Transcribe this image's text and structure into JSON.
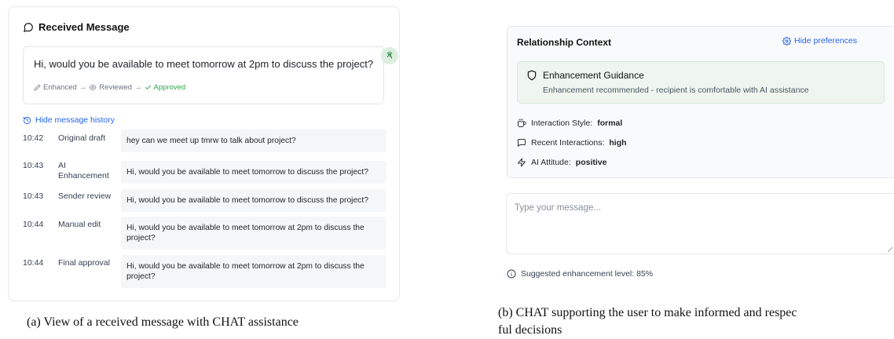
{
  "panel_a": {
    "header": "Received Message",
    "message": "Hi, would you be available to meet tomorrow at 2pm to discuss the project?",
    "pipeline": {
      "enhanced": "Enhanced",
      "reviewed": "Reviewed",
      "approved": "Approved",
      "arrow": "→"
    },
    "history_toggle": "Hide message history",
    "history": [
      {
        "time": "10:42",
        "label": "Original draft",
        "text": "hey can we meet up tmrw to talk about project?"
      },
      {
        "time": "10:43",
        "label": "AI Enhancement",
        "text": "Hi, would you be available to meet tomorrow to discuss the project?"
      },
      {
        "time": "10:43",
        "label": "Sender review",
        "text": "Hi, would you be available to meet tomorrow to discuss the project?"
      },
      {
        "time": "10:44",
        "label": "Manual edit",
        "text": "Hi, would you be available to meet tomorrow at 2pm to discuss the project?"
      },
      {
        "time": "10:44",
        "label": "Final approval",
        "text": "Hi, would you be available to meet tomorrow at 2pm to discuss the project?"
      }
    ],
    "caption": "(a) View of a received message with CHAT assistance"
  },
  "panel_b": {
    "relationship_title": "Relationship Context",
    "hide_preferences": "Hide preferences",
    "guidance_title": "Enhancement Guidance",
    "guidance_desc": "Enhancement recommended - recipient is comfortable with AI assistance",
    "attributes": [
      {
        "label": "Interaction Style:",
        "value": "formal",
        "icon": "coffee-icon"
      },
      {
        "label": "Recent Interactions:",
        "value": "high",
        "icon": "message-square-icon"
      },
      {
        "label": "AI Attitude:",
        "value": "positive",
        "icon": "zap-icon"
      }
    ],
    "compose_placeholder": "Type your message...",
    "suggestion": "Suggested enhancement level: 85%",
    "caption_line1": "(b) CHAT supporting the user to make informed and respec",
    "caption_line2": "ful decisions"
  },
  "colors": {
    "accent_blue": "#2563eb",
    "approved_green": "#2fa84f",
    "guidance_bg": "#eef6ef"
  }
}
